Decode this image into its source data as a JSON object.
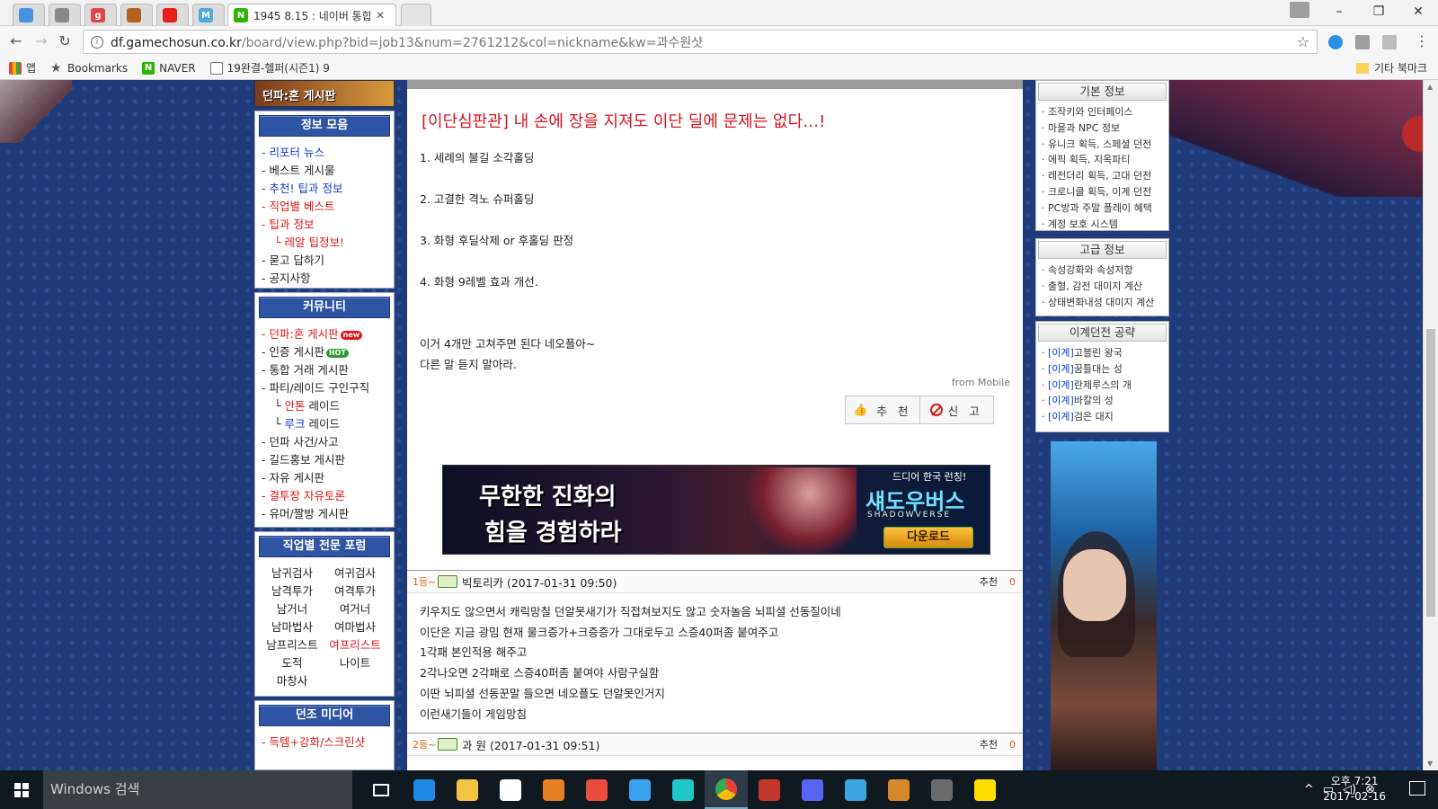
{
  "browser": {
    "tabs": [
      {
        "title": "",
        "favicon": "settings-tab-favicon",
        "color": "#4a90e2"
      },
      {
        "title": "",
        "favicon": "window-tab-favicon",
        "color": "#888888"
      },
      {
        "title": "",
        "favicon": "g-favicon",
        "label": "g",
        "color": "#e0454a"
      },
      {
        "title": "",
        "favicon": "df-favicon",
        "color": "#b06020"
      },
      {
        "title": "",
        "favicon": "youtube-favicon",
        "color": "#e62117"
      },
      {
        "title": "",
        "favicon": "m-favicon",
        "label": "M",
        "color": "#4fa7e0"
      },
      {
        "title": "1945 8.15 : 네이버 통합",
        "favicon": "naver-favicon",
        "label": "N",
        "color": "#2db400",
        "active": true
      }
    ],
    "url_host": "df.gamechosun.co.kr",
    "url_rest": "/board/view.php?bid=job13&num=2761212&col=nickname&kw=과수원샷",
    "bookmarks": [
      {
        "label": "앱",
        "icon": "apps-icon"
      },
      {
        "label": "Bookmarks",
        "icon": "star-icon"
      },
      {
        "label": "NAVER",
        "icon": "naver-icon"
      },
      {
        "label": "19완결-헬퍼(시즌1) 9",
        "icon": "page-icon"
      }
    ],
    "other_bookmarks": "기타 북마크"
  },
  "left_sidebar": {
    "banner": "던파:혼 게시판",
    "info": {
      "title": "정보 모음",
      "items": [
        {
          "label": "리포터 뉴스",
          "style": "blue"
        },
        {
          "label": "베스트 게시물",
          "style": ""
        },
        {
          "label": "추천! 팁과 정보",
          "style": "blue"
        },
        {
          "label": "직업별 베스트",
          "style": "red"
        },
        {
          "label": "팁과 정보",
          "style": "red"
        },
        {
          "label": "레알 팁정보!",
          "style": "red sub"
        },
        {
          "label": "묻고 답하기",
          "style": ""
        },
        {
          "label": "공지사항",
          "style": ""
        }
      ]
    },
    "community": {
      "title": "커뮤니티",
      "items": [
        {
          "label": "던파:혼 게시판",
          "style": "red",
          "badge": "new"
        },
        {
          "label": "인증 게시판",
          "style": "",
          "badge": "HOT"
        },
        {
          "label": "통합 거래 게시판",
          "style": ""
        },
        {
          "label": "파티/레이드 구인구직",
          "style": ""
        },
        {
          "label": "안톤 레이드",
          "style": "sub",
          "highlight": "안톤",
          "rest": " 레이드",
          "hcolor": "#e0181a"
        },
        {
          "label": "루크 레이드",
          "style": "sub",
          "highlight": "루크",
          "rest": " 레이드",
          "hcolor": "#1a3ad0"
        },
        {
          "label": "던파 사건/사고",
          "style": ""
        },
        {
          "label": "길드홍보 게시판",
          "style": ""
        },
        {
          "label": "자유 게시판",
          "style": ""
        },
        {
          "label": "결투장 자유토론",
          "style": "red"
        },
        {
          "label": "유머/짤방 게시판",
          "style": ""
        }
      ]
    },
    "jobs": {
      "title": "직업별 전문 포럼",
      "items": [
        "남귀검사",
        "여귀검사",
        "남격투가",
        "여격투가",
        "남거너",
        "여거너",
        "남마법사",
        "여마법사",
        "남프리스트",
        "여프리스트",
        "도적",
        "나이트",
        "마창사",
        ""
      ]
    },
    "media": {
      "title": "던조 미디어",
      "items": [
        {
          "label": "득템+강화/스크린샷",
          "style": "red"
        }
      ]
    }
  },
  "post": {
    "title": "[이단심판관] 내 손에 장을 지져도 이단 딜에 문제는 없다…!",
    "lines": [
      "1. 세례의 불길 소각홀딩",
      "",
      "2. 고결한 격노 슈퍼홀딩",
      "",
      "3. 화형 후딜삭제 or 후홀딩 판정",
      "",
      "4. 화형 9레벨 효과 개선.",
      "",
      "",
      "이거 4개만 고쳐주면 된다 네오플아~",
      "다른 말 듣지 말아라."
    ],
    "from": "from Mobile",
    "recommend_label": "추 천",
    "report_label": "신 고"
  },
  "ad": {
    "line1": "무한한 진화의",
    "line2": "힘을 경험하라",
    "tagline": "드디어 한국 런칭!",
    "brand": "섀도우버스",
    "brand_en": "SHADOWVERSE",
    "cta": "다운로드"
  },
  "comments": [
    {
      "rank": "1등~",
      "author": "빅토리카 (2017-01-31 09:50)",
      "rec_label": "추천",
      "rec_count": "0",
      "lines": [
        "키우지도 않으면서 캐릭망칠 던알못새기가 직접쳐보지도 않고 숫자놀음 뇌피셜 선동질이네",
        "이단은 지금 광밈 현재 물크증가+크증증가 그대로두고 스증40퍼좀 붙여주고",
        "1각패 본인적용 해주고",
        "2각나오면 2각패로 스증40퍼좀 붙여야 사람구실함",
        "이딴 뇌피셜 선동꾼말 들으면 네오플도 던알못인거지",
        "이런새기들이 게임망침"
      ]
    },
    {
      "rank": "2등~",
      "author": "과  원   (2017-01-31 09:51)",
      "rec_label": "추천",
      "rec_count": "0",
      "lines": []
    }
  ],
  "right_sidebar": {
    "basic": {
      "title": "기본 정보",
      "items": [
        "조작키와 인터페이스",
        "마을과 NPC 정보",
        "유니크 획득, 스페셜 던전",
        "에픽 획득, 지옥파티",
        "레전더리 획득, 고대 던전",
        "크로니클 획득, 이계 던전",
        "PC방과 주말 플레이 혜택",
        "계정 보호 시스템"
      ]
    },
    "advanced": {
      "title": "고급 정보",
      "items": [
        "속성강화와 속성저항",
        "출혈, 감전 대미지 계산",
        "상태변화내성 대미지 계산"
      ]
    },
    "otherworld": {
      "title": "이계던전 공략",
      "items": [
        {
          "tag": "[이계]",
          "label": "고블린 왕국"
        },
        {
          "tag": "[이계]",
          "label": "꿈틀대는 성"
        },
        {
          "tag": "[이계]",
          "label": "란제루스의 개"
        },
        {
          "tag": "[이계]",
          "label": "바칼의 성"
        },
        {
          "tag": "[이계]",
          "label": "검은 대지"
        }
      ]
    }
  },
  "taskbar": {
    "search_placeholder": "Windows 검색",
    "time": "오후 7:21",
    "date": "2017-02-16",
    "apps": [
      {
        "name": "task-view-icon",
        "color": "#ffffff"
      },
      {
        "name": "edge-icon",
        "color": "#1e88e5"
      },
      {
        "name": "file-explorer-icon",
        "color": "#f4c542"
      },
      {
        "name": "store-icon",
        "color": "#ffffff"
      },
      {
        "name": "media-player-icon",
        "color": "#e67e22"
      },
      {
        "name": "u-app-icon",
        "color": "#e74c3c"
      },
      {
        "name": "play-app-icon",
        "color": "#3aa0f0"
      },
      {
        "name": "tiktok-app-icon",
        "color": "#1ec8c8"
      },
      {
        "name": "chrome-icon",
        "color": "#34a853"
      },
      {
        "name": "game-app-icon",
        "color": "#c0392b"
      },
      {
        "name": "compass-app-icon",
        "color": "#5865f2"
      },
      {
        "name": "ie-app-icon",
        "color": "#3aa6e0"
      },
      {
        "name": "df-app-icon",
        "color": "#d4882a"
      },
      {
        "name": "nox-app-icon",
        "color": "#6a6a6a"
      },
      {
        "name": "kakaotalk-icon",
        "color": "#ffe000"
      }
    ]
  }
}
